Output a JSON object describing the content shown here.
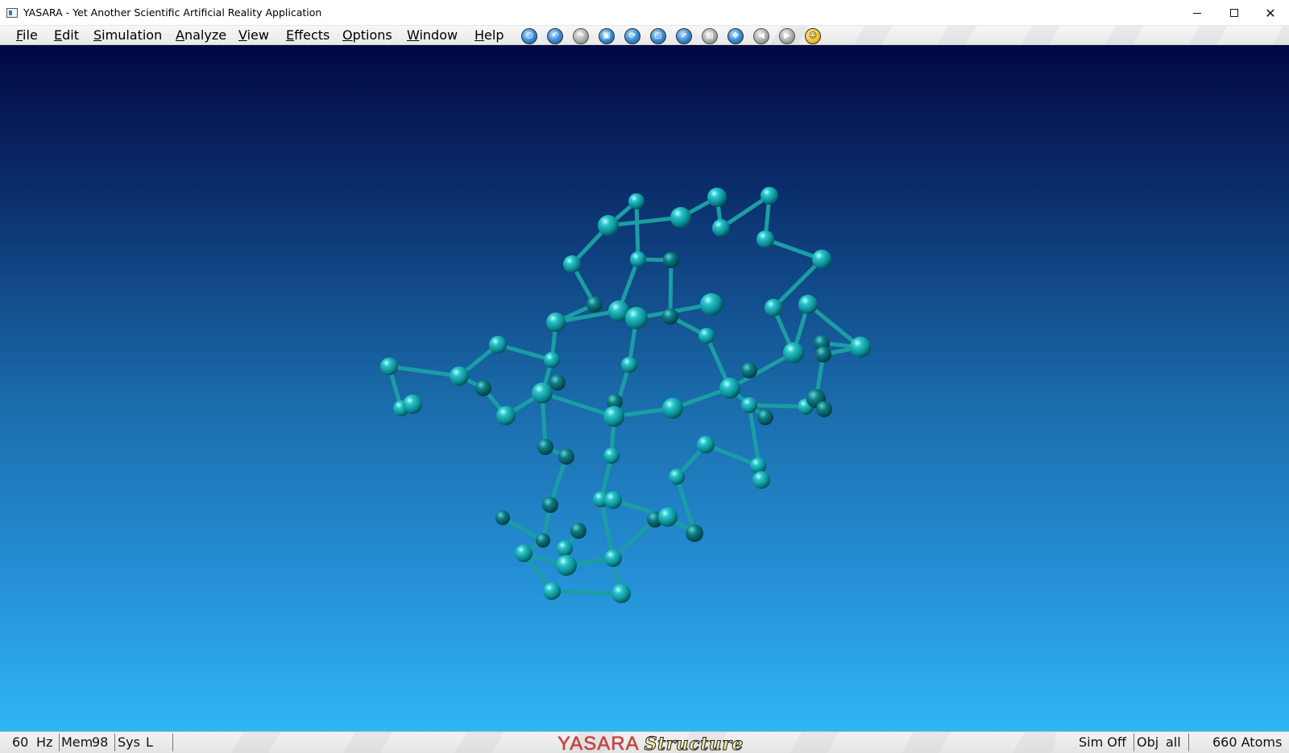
{
  "window": {
    "title": "YASARA - Yet Another Scientific Artificial Reality Application",
    "controls": {
      "minimize": "minimize-icon",
      "maximize": "maximize-icon",
      "close": "close-icon"
    }
  },
  "menu": {
    "items": [
      "File",
      "Edit",
      "Simulation",
      "Analyze",
      "View",
      "Effects",
      "Options",
      "Window",
      "Help"
    ]
  },
  "toolbar": {
    "icons": [
      "hexagon-icon",
      "undo-icon",
      "redo-icon",
      "select-icon",
      "rotate-icon",
      "page-icon",
      "forward-icon",
      "save-icon",
      "center-icon",
      "rewind-icon",
      "fast-forward-icon",
      "face-icon"
    ]
  },
  "viewport": {
    "background_colors": [
      "#020842",
      "#2fb6f4"
    ],
    "atom_color": "#1aa3a8"
  },
  "statusbar": {
    "fps_value": "60",
    "fps_unit": "Hz",
    "mem_label": "Mem",
    "mem_value": "98",
    "sys_label": "Sys",
    "sys_value": "L",
    "brand_part1": "YASARA",
    "brand_part2": "Structure",
    "sim_status": "Sim Off",
    "obj_label": "Obj",
    "obj_value": "all",
    "atom_count": "660 Atoms"
  }
}
